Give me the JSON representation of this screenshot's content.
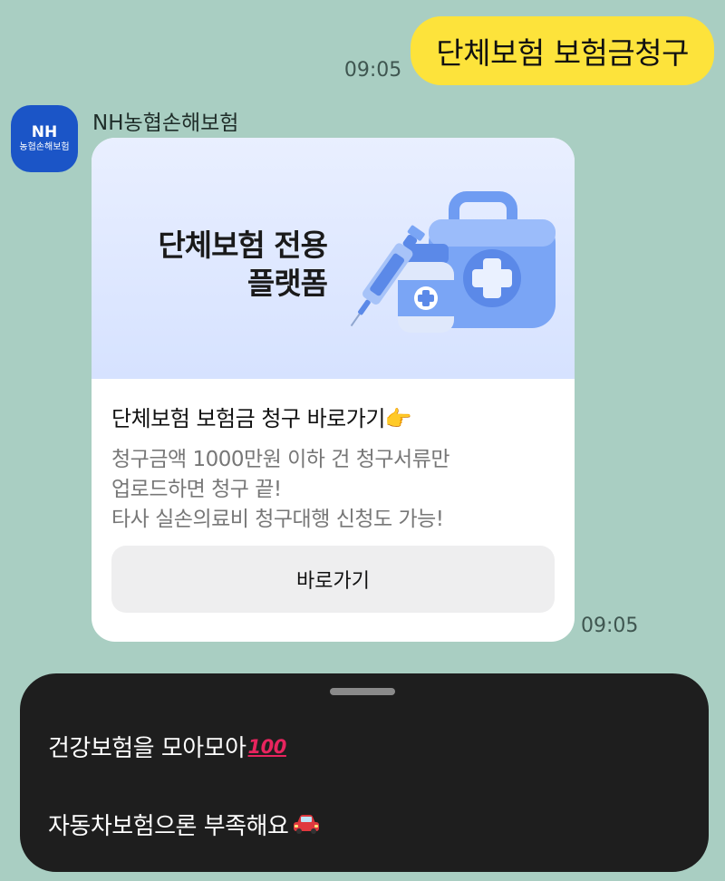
{
  "outgoing": {
    "text": "단체보험 보험금청구",
    "time": "09:05"
  },
  "sender": {
    "name": "NH농협손해보험",
    "avatar_top": "NH",
    "avatar_sub": "농협손해보험"
  },
  "card": {
    "banner_line1": "단체보험 전용",
    "banner_line2": "플랫폼",
    "title": "단체보험 보험금 청구 바로가기👉",
    "desc_line1": "청구금액 1000만원 이하 건 청구서류만",
    "desc_line2": "업로드하면 청구 끝!",
    "desc_line3": "타사 실손의료비 청구대행 신청도 가능!",
    "button_label": "바로가기",
    "time": "09:05"
  },
  "sheet": {
    "item1_text": "건강보험을 모아모아",
    "item1_emoji": "100",
    "item2_text": "자동차보험으론 부족해요",
    "item2_emoji": "car-icon"
  },
  "colors": {
    "background": "#a9cec2",
    "bubble": "#fde33b",
    "brand": "#1b55c7",
    "sheet": "#1e1e1e"
  }
}
